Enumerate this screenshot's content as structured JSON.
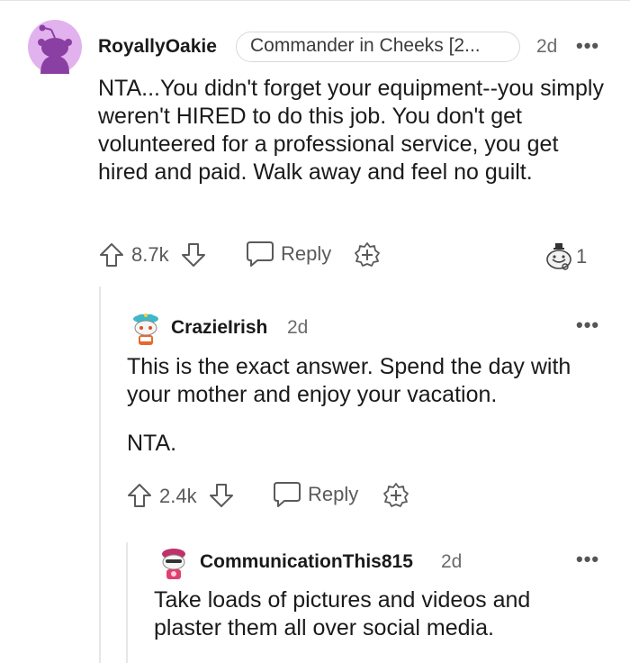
{
  "comments": [
    {
      "username": "RoyallyOakie",
      "flair": "Commander in Cheeks [2...",
      "time": "2d",
      "more_label": "•••",
      "body": [
        "NTA...You didn't forget your equipment--you simply weren't HIRED to do this job. You don't get volunteered for a professional service, you get hired and paid. Walk away and feel no guilt."
      ],
      "votes": "8.7k",
      "reply_label": "Reply",
      "award_count": "1"
    },
    {
      "username": "CrazieIrish",
      "time": "2d",
      "more_label": "•••",
      "body": [
        "This is the exact answer. Spend the day with your mother and enjoy your vacation.",
        "NTA."
      ],
      "votes": "2.4k",
      "reply_label": "Reply"
    },
    {
      "username": "CommunicationThis815",
      "time": "2d",
      "more_label": "•••",
      "body": [
        "Take loads of pictures and videos and plaster them all over social media."
      ]
    }
  ],
  "colors": {
    "avatar1_bg": "#e2b2ee",
    "avatar1_fg": "#8a3fa3",
    "thread_line": "#e6e6e6",
    "text": "#1a1a1b",
    "meta": "#6b6b6b"
  },
  "icons": [
    "upvote-icon",
    "downvote-icon",
    "reply-bubble-icon",
    "award-icon",
    "award-badge-icon",
    "more-icon"
  ]
}
